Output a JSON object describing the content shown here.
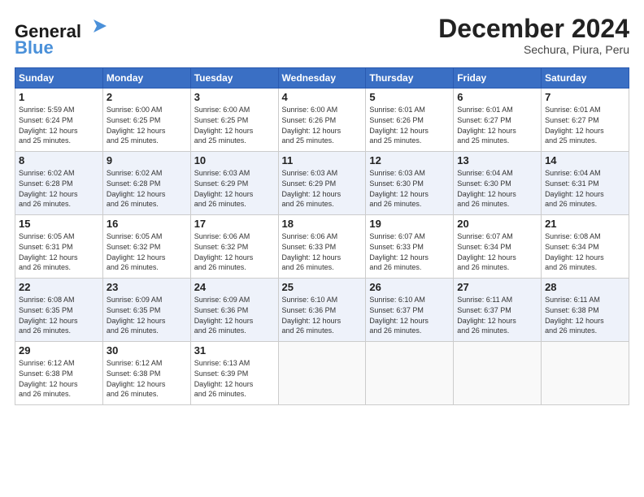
{
  "header": {
    "logo_line1": "General",
    "logo_line2": "Blue",
    "month": "December 2024",
    "location": "Sechura, Piura, Peru"
  },
  "weekdays": [
    "Sunday",
    "Monday",
    "Tuesday",
    "Wednesday",
    "Thursday",
    "Friday",
    "Saturday"
  ],
  "weeks": [
    [
      {
        "day": "1",
        "info": "Sunrise: 5:59 AM\nSunset: 6:24 PM\nDaylight: 12 hours\nand 25 minutes."
      },
      {
        "day": "2",
        "info": "Sunrise: 6:00 AM\nSunset: 6:25 PM\nDaylight: 12 hours\nand 25 minutes."
      },
      {
        "day": "3",
        "info": "Sunrise: 6:00 AM\nSunset: 6:25 PM\nDaylight: 12 hours\nand 25 minutes."
      },
      {
        "day": "4",
        "info": "Sunrise: 6:00 AM\nSunset: 6:26 PM\nDaylight: 12 hours\nand 25 minutes."
      },
      {
        "day": "5",
        "info": "Sunrise: 6:01 AM\nSunset: 6:26 PM\nDaylight: 12 hours\nand 25 minutes."
      },
      {
        "day": "6",
        "info": "Sunrise: 6:01 AM\nSunset: 6:27 PM\nDaylight: 12 hours\nand 25 minutes."
      },
      {
        "day": "7",
        "info": "Sunrise: 6:01 AM\nSunset: 6:27 PM\nDaylight: 12 hours\nand 25 minutes."
      }
    ],
    [
      {
        "day": "8",
        "info": "Sunrise: 6:02 AM\nSunset: 6:28 PM\nDaylight: 12 hours\nand 26 minutes."
      },
      {
        "day": "9",
        "info": "Sunrise: 6:02 AM\nSunset: 6:28 PM\nDaylight: 12 hours\nand 26 minutes."
      },
      {
        "day": "10",
        "info": "Sunrise: 6:03 AM\nSunset: 6:29 PM\nDaylight: 12 hours\nand 26 minutes."
      },
      {
        "day": "11",
        "info": "Sunrise: 6:03 AM\nSunset: 6:29 PM\nDaylight: 12 hours\nand 26 minutes."
      },
      {
        "day": "12",
        "info": "Sunrise: 6:03 AM\nSunset: 6:30 PM\nDaylight: 12 hours\nand 26 minutes."
      },
      {
        "day": "13",
        "info": "Sunrise: 6:04 AM\nSunset: 6:30 PM\nDaylight: 12 hours\nand 26 minutes."
      },
      {
        "day": "14",
        "info": "Sunrise: 6:04 AM\nSunset: 6:31 PM\nDaylight: 12 hours\nand 26 minutes."
      }
    ],
    [
      {
        "day": "15",
        "info": "Sunrise: 6:05 AM\nSunset: 6:31 PM\nDaylight: 12 hours\nand 26 minutes."
      },
      {
        "day": "16",
        "info": "Sunrise: 6:05 AM\nSunset: 6:32 PM\nDaylight: 12 hours\nand 26 minutes."
      },
      {
        "day": "17",
        "info": "Sunrise: 6:06 AM\nSunset: 6:32 PM\nDaylight: 12 hours\nand 26 minutes."
      },
      {
        "day": "18",
        "info": "Sunrise: 6:06 AM\nSunset: 6:33 PM\nDaylight: 12 hours\nand 26 minutes."
      },
      {
        "day": "19",
        "info": "Sunrise: 6:07 AM\nSunset: 6:33 PM\nDaylight: 12 hours\nand 26 minutes."
      },
      {
        "day": "20",
        "info": "Sunrise: 6:07 AM\nSunset: 6:34 PM\nDaylight: 12 hours\nand 26 minutes."
      },
      {
        "day": "21",
        "info": "Sunrise: 6:08 AM\nSunset: 6:34 PM\nDaylight: 12 hours\nand 26 minutes."
      }
    ],
    [
      {
        "day": "22",
        "info": "Sunrise: 6:08 AM\nSunset: 6:35 PM\nDaylight: 12 hours\nand 26 minutes."
      },
      {
        "day": "23",
        "info": "Sunrise: 6:09 AM\nSunset: 6:35 PM\nDaylight: 12 hours\nand 26 minutes."
      },
      {
        "day": "24",
        "info": "Sunrise: 6:09 AM\nSunset: 6:36 PM\nDaylight: 12 hours\nand 26 minutes."
      },
      {
        "day": "25",
        "info": "Sunrise: 6:10 AM\nSunset: 6:36 PM\nDaylight: 12 hours\nand 26 minutes."
      },
      {
        "day": "26",
        "info": "Sunrise: 6:10 AM\nSunset: 6:37 PM\nDaylight: 12 hours\nand 26 minutes."
      },
      {
        "day": "27",
        "info": "Sunrise: 6:11 AM\nSunset: 6:37 PM\nDaylight: 12 hours\nand 26 minutes."
      },
      {
        "day": "28",
        "info": "Sunrise: 6:11 AM\nSunset: 6:38 PM\nDaylight: 12 hours\nand 26 minutes."
      }
    ],
    [
      {
        "day": "29",
        "info": "Sunrise: 6:12 AM\nSunset: 6:38 PM\nDaylight: 12 hours\nand 26 minutes."
      },
      {
        "day": "30",
        "info": "Sunrise: 6:12 AM\nSunset: 6:38 PM\nDaylight: 12 hours\nand 26 minutes."
      },
      {
        "day": "31",
        "info": "Sunrise: 6:13 AM\nSunset: 6:39 PM\nDaylight: 12 hours\nand 26 minutes."
      },
      {
        "day": "",
        "info": ""
      },
      {
        "day": "",
        "info": ""
      },
      {
        "day": "",
        "info": ""
      },
      {
        "day": "",
        "info": ""
      }
    ]
  ]
}
